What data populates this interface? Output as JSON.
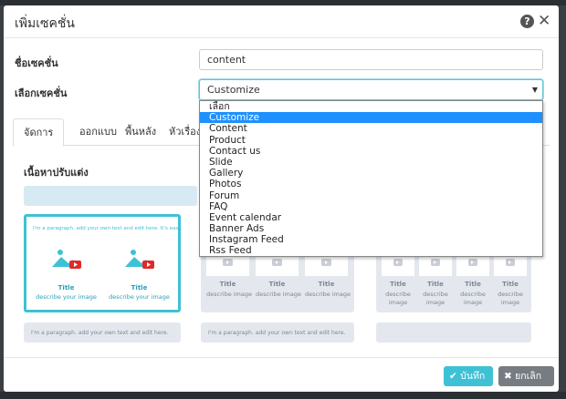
{
  "modal": {
    "title": "เพิ่มเซคชั่น",
    "help_icon": "question-circle-icon",
    "close_icon": "close-icon"
  },
  "form": {
    "name_label": "ชื่อเซคชั่น",
    "name_value": "content",
    "type_label": "เลือกเซคชั่น",
    "type_value": "Customize"
  },
  "dropdown": {
    "options": [
      "เลือก",
      "Customize",
      "Content",
      "Product",
      "Contact us",
      "Slide",
      "Gallery",
      "Photos",
      "Forum",
      "FAQ",
      "Event calendar",
      "Banner Ads",
      "Instagram Feed",
      "Rss Feed"
    ],
    "selected_index": 1
  },
  "tabs": [
    {
      "label": "จัดการ",
      "active": true
    },
    {
      "label": "ออกแบบ",
      "active": false
    },
    {
      "label": "พื้นหลัง",
      "active": false
    },
    {
      "label": "หัวเรื่อง",
      "active": false
    }
  ],
  "content": {
    "heading": "เนื้อหาปรับแต่ง",
    "paragraph_long": "I'm a paragraph. add your own text and edit here. It's easy.",
    "paragraph_short": "I'm a paragraph. add your own text and edit here.",
    "tile_title": "Title",
    "tile_desc": "describe your image",
    "tile_desc_short": "describe image",
    "image_icon": "image-icon",
    "video_icon": "youtube-play-icon"
  },
  "footer": {
    "save_label": "บันทึก",
    "save_icon": "check-icon",
    "cancel_label": "ยกเลิก",
    "cancel_icon": "times-icon"
  },
  "colors": {
    "accent": "#3ec1d5",
    "dropdown_highlight": "#1e90ff",
    "cancel": "#777c82"
  }
}
